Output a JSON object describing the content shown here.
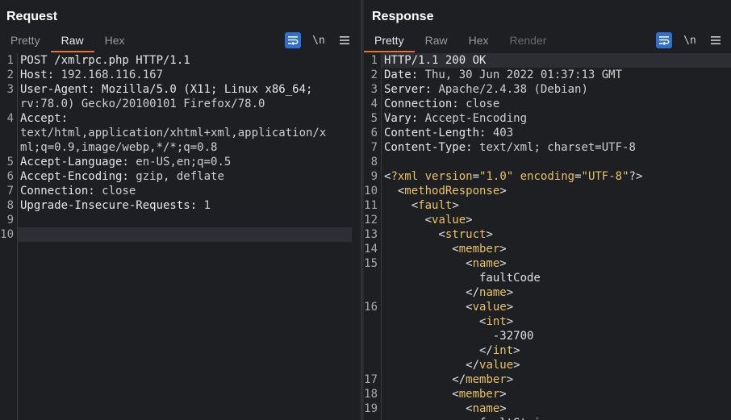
{
  "request": {
    "title": "Request",
    "tabs": [
      "Pretty",
      "Raw",
      "Hex"
    ],
    "active_tab": "Raw",
    "newline_label": "\\n",
    "lines": [
      {
        "n": "1",
        "segments": [
          [
            "POST /xmlrpc.php HTTP/1.1",
            "plain"
          ]
        ]
      },
      {
        "n": "2",
        "segments": [
          [
            "Host: ",
            "name"
          ],
          [
            "192.168.116.167",
            "val"
          ]
        ]
      },
      {
        "n": "3",
        "wrap": [
          "User-Agent: Mozilla/5.0 (X11; Linux x86_64;",
          "rv:78.0) Gecko/20100101 Firefox/78.0"
        ]
      },
      {
        "n": "4",
        "wrap": [
          "Accept:",
          "text/html,application/xhtml+xml,application/x",
          "ml;q=0.9,image/webp,*/*;q=0.8"
        ]
      },
      {
        "n": "5",
        "segments": [
          [
            "Accept-Language: ",
            "name"
          ],
          [
            "en-US,en;q=0.5",
            "val"
          ]
        ]
      },
      {
        "n": "6",
        "segments": [
          [
            "Accept-Encoding: ",
            "name"
          ],
          [
            "gzip, deflate",
            "val"
          ]
        ]
      },
      {
        "n": "7",
        "segments": [
          [
            "Connection: ",
            "name"
          ],
          [
            "close",
            "val"
          ]
        ]
      },
      {
        "n": "8",
        "segments": [
          [
            "Upgrade-Insecure-Requests: ",
            "name"
          ],
          [
            "1",
            "val"
          ]
        ]
      },
      {
        "n": "9",
        "segments": []
      },
      {
        "n": "10",
        "segments": [],
        "current": true
      }
    ]
  },
  "response": {
    "title": "Response",
    "tabs": [
      "Pretty",
      "Raw",
      "Hex",
      "Render"
    ],
    "active_tab": "Pretty",
    "disabled_tab": "Render",
    "newline_label": "\\n",
    "lines": [
      {
        "n": "1",
        "segments": [
          [
            "HTTP/1.1 200 OK",
            "plain"
          ]
        ],
        "current": true
      },
      {
        "n": "2",
        "segments": [
          [
            "Date: ",
            "name"
          ],
          [
            "Thu, 30 Jun 2022 01:37:13 GMT",
            "val"
          ]
        ]
      },
      {
        "n": "3",
        "segments": [
          [
            "Server: ",
            "name"
          ],
          [
            "Apache/2.4.38 (Debian)",
            "val"
          ]
        ]
      },
      {
        "n": "4",
        "segments": [
          [
            "Connection: ",
            "name"
          ],
          [
            "close",
            "val"
          ]
        ]
      },
      {
        "n": "5",
        "segments": [
          [
            "Vary: ",
            "name"
          ],
          [
            "Accept-Encoding",
            "val"
          ]
        ]
      },
      {
        "n": "6",
        "segments": [
          [
            "Content-Length: ",
            "name"
          ],
          [
            "403",
            "val"
          ]
        ]
      },
      {
        "n": "7",
        "segments": [
          [
            "Content-Type: ",
            "name"
          ],
          [
            "text/xml; charset=UTF-8",
            "val"
          ]
        ]
      },
      {
        "n": "8",
        "segments": []
      },
      {
        "n": "9",
        "segments": [
          [
            "<",
            "xml-punct"
          ],
          [
            "?xml",
            "xml-tag"
          ],
          [
            " ",
            "xml-text"
          ],
          [
            "version",
            "xml-attr"
          ],
          [
            "=",
            "xml-punct"
          ],
          [
            "\"1.0\"",
            "xml-str"
          ],
          [
            " ",
            "xml-text"
          ],
          [
            "encoding",
            "xml-attr"
          ],
          [
            "=",
            "xml-punct"
          ],
          [
            "\"UTF-8\"",
            "xml-str"
          ],
          [
            "?>",
            "xml-punct"
          ]
        ]
      },
      {
        "n": "10",
        "segments": [
          [
            "  <",
            "xml-punct"
          ],
          [
            "methodResponse",
            "xml-tag"
          ],
          [
            ">",
            "xml-punct"
          ]
        ]
      },
      {
        "n": "11",
        "segments": [
          [
            "    <",
            "xml-punct"
          ],
          [
            "fault",
            "xml-tag"
          ],
          [
            ">",
            "xml-punct"
          ]
        ]
      },
      {
        "n": "12",
        "segments": [
          [
            "      <",
            "xml-punct"
          ],
          [
            "value",
            "xml-tag"
          ],
          [
            ">",
            "xml-punct"
          ]
        ]
      },
      {
        "n": "13",
        "segments": [
          [
            "        <",
            "xml-punct"
          ],
          [
            "struct",
            "xml-tag"
          ],
          [
            ">",
            "xml-punct"
          ]
        ]
      },
      {
        "n": "14",
        "segments": [
          [
            "          <",
            "xml-punct"
          ],
          [
            "member",
            "xml-tag"
          ],
          [
            ">",
            "xml-punct"
          ]
        ]
      },
      {
        "n": "15",
        "block": [
          [
            [
              "            <",
              "xml-punct"
            ],
            [
              "name",
              "xml-tag"
            ],
            [
              ">",
              "xml-punct"
            ]
          ],
          [
            [
              "              faultCode",
              "xml-text"
            ]
          ],
          [
            [
              "            </",
              "xml-punct"
            ],
            [
              "name",
              "xml-tag"
            ],
            [
              ">",
              "xml-punct"
            ]
          ]
        ]
      },
      {
        "n": "16",
        "block": [
          [
            [
              "            <",
              "xml-punct"
            ],
            [
              "value",
              "xml-tag"
            ],
            [
              ">",
              "xml-punct"
            ]
          ],
          [
            [
              "              <",
              "xml-punct"
            ],
            [
              "int",
              "xml-tag"
            ],
            [
              ">",
              "xml-punct"
            ]
          ],
          [
            [
              "                -32700",
              "xml-text"
            ]
          ],
          [
            [
              "              </",
              "xml-punct"
            ],
            [
              "int",
              "xml-tag"
            ],
            [
              ">",
              "xml-punct"
            ]
          ],
          [
            [
              "            </",
              "xml-punct"
            ],
            [
              "value",
              "xml-tag"
            ],
            [
              ">",
              "xml-punct"
            ]
          ]
        ]
      },
      {
        "n": "17",
        "segments": [
          [
            "          </",
            "xml-punct"
          ],
          [
            "member",
            "xml-tag"
          ],
          [
            ">",
            "xml-punct"
          ]
        ]
      },
      {
        "n": "18",
        "segments": [
          [
            "          <",
            "xml-punct"
          ],
          [
            "member",
            "xml-tag"
          ],
          [
            ">",
            "xml-punct"
          ]
        ]
      },
      {
        "n": "19",
        "block": [
          [
            [
              "            <",
              "xml-punct"
            ],
            [
              "name",
              "xml-tag"
            ],
            [
              ">",
              "xml-punct"
            ]
          ],
          [
            [
              "              faultString",
              "xml-text"
            ]
          ]
        ]
      }
    ]
  },
  "layout_switcher": {
    "options": [
      "side-by-side",
      "stacked-horizontal",
      "tabbed"
    ],
    "active": "side-by-side"
  }
}
